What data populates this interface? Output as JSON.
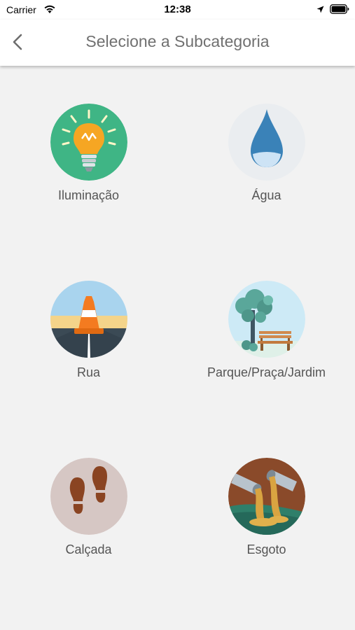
{
  "status": {
    "carrier": "Carrier",
    "time": "12:38"
  },
  "nav": {
    "title": "Selecione a Subcategoria"
  },
  "items": [
    {
      "label": "Iluminação",
      "icon": "lightbulb-icon"
    },
    {
      "label": "Água",
      "icon": "water-drop-icon"
    },
    {
      "label": "Rua",
      "icon": "road-cone-icon"
    },
    {
      "label": "Parque/Praça/Jardim",
      "icon": "park-bench-icon"
    },
    {
      "label": "Calçada",
      "icon": "footprints-icon"
    },
    {
      "label": "Esgoto",
      "icon": "sewer-pipe-icon"
    }
  ],
  "colors": {
    "background": "#f2f2f2",
    "title": "#707070",
    "label": "#555555"
  }
}
